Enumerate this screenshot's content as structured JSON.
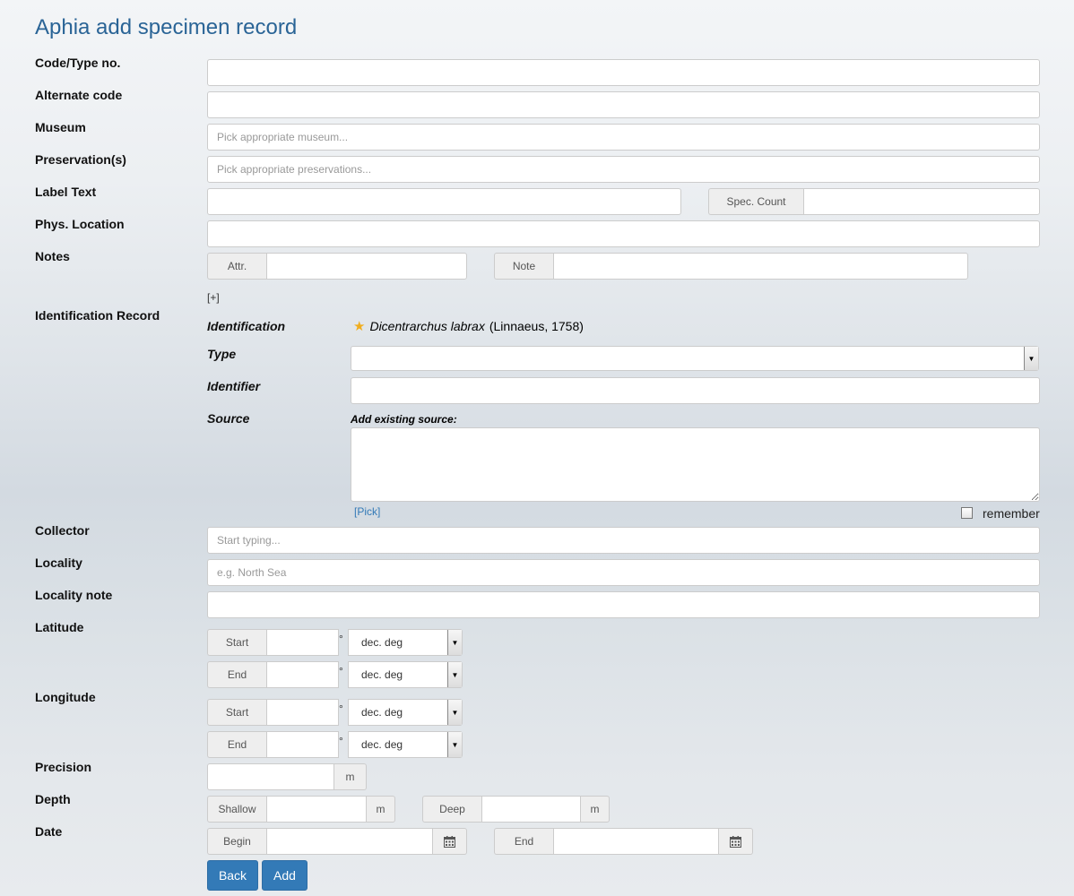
{
  "page": {
    "title": "Aphia add specimen record"
  },
  "labels": {
    "code": "Code/Type no.",
    "alternate": "Alternate code",
    "museum": "Museum",
    "preservation": "Preservation(s)",
    "label_text": "Label Text",
    "phys_location": "Phys. Location",
    "notes": "Notes",
    "identification_record": "Identification Record",
    "collector": "Collector",
    "locality": "Locality",
    "locality_note": "Locality note",
    "latitude": "Latitude",
    "longitude": "Longitude",
    "precision": "Precision",
    "depth": "Depth",
    "date": "Date"
  },
  "fields": {
    "museum_placeholder": "Pick appropriate museum...",
    "preservation_placeholder": "Pick appropriate preservations...",
    "spec_count_label": "Spec. Count",
    "attr_label": "Attr.",
    "note_label": "Note",
    "expand_link": "[+]",
    "collector_placeholder": "Start typing...",
    "locality_placeholder": "e.g. North Sea"
  },
  "identification": {
    "label_identification": "Identification",
    "taxon_name": "Dicentrarchus labrax",
    "taxon_author": "(Linnaeus, 1758)",
    "label_type": "Type",
    "label_identifier": "Identifier",
    "label_source": "Source",
    "add_source_label": "Add existing source:",
    "pick_link": "[Pick]",
    "remember_label": "remember",
    "star_icon": "star-icon"
  },
  "coords": {
    "start_label": "Start",
    "end_label": "End",
    "degree_symbol": "°",
    "unit_option": "dec. deg"
  },
  "precision": {
    "unit": "m"
  },
  "depth": {
    "shallow_label": "Shallow",
    "deep_label": "Deep",
    "unit": "m"
  },
  "date": {
    "begin_label": "Begin",
    "end_label": "End",
    "calendar_icon": "calendar-icon"
  },
  "buttons": {
    "back": "Back",
    "add": "Add"
  }
}
